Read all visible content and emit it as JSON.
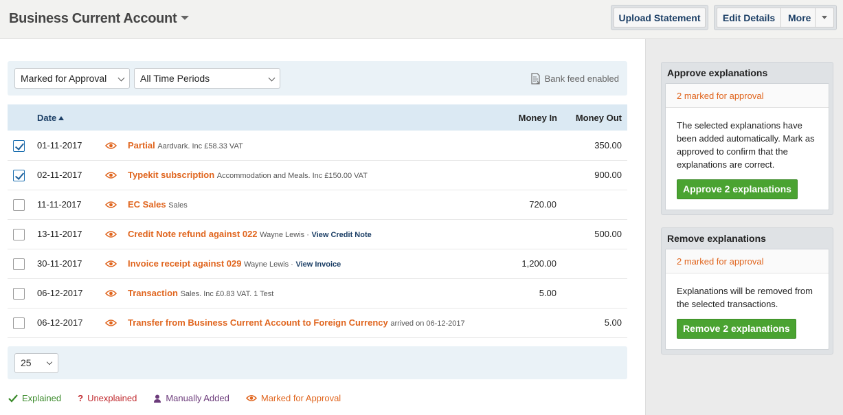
{
  "header": {
    "account_title": "Business Current Account",
    "upload_label": "Upload Statement",
    "edit_label": "Edit Details",
    "more_label": "More"
  },
  "filters": {
    "status_value": "Marked for Approval",
    "period_value": "All Time Periods",
    "bank_feed": "Bank feed enabled"
  },
  "table": {
    "col_date": "Date",
    "col_in": "Money In",
    "col_out": "Money Out",
    "rows": [
      {
        "checked": true,
        "date": "01-11-2017",
        "title": "Partial",
        "sub": "Aardvark. Inc £58.33 VAT",
        "link": "",
        "in": "",
        "out": "350.00"
      },
      {
        "checked": true,
        "date": "02-11-2017",
        "title": "Typekit subscription",
        "sub": "Accommodation and Meals. Inc £150.00 VAT",
        "link": "",
        "in": "",
        "out": "900.00"
      },
      {
        "checked": false,
        "date": "11-11-2017",
        "title": "EC Sales",
        "sub": "Sales",
        "link": "",
        "in": "720.00",
        "out": ""
      },
      {
        "checked": false,
        "date": "13-11-2017",
        "title": "Credit Note refund against 022",
        "sub": "Wayne Lewis ·",
        "link": "View Credit Note",
        "in": "",
        "out": "500.00"
      },
      {
        "checked": false,
        "date": "30-11-2017",
        "title": "Invoice receipt against 029",
        "sub": "Wayne Lewis ·",
        "link": "View Invoice",
        "in": "1,200.00",
        "out": ""
      },
      {
        "checked": false,
        "date": "06-12-2017",
        "title": "Transaction",
        "sub": "Sales. Inc £0.83 VAT. 1 Test",
        "link": "",
        "in": "5.00",
        "out": ""
      },
      {
        "checked": false,
        "date": "06-12-2017",
        "title": "Transfer from Business Current Account to Foreign Currency",
        "sub": "arrived on 06-12-2017",
        "link": "",
        "in": "",
        "out": "5.00"
      }
    ]
  },
  "pagination": {
    "per_page": "25"
  },
  "legend": {
    "explained": "Explained",
    "unexplained": "Unexplained",
    "manual": "Manually Added",
    "approval": "Marked for Approval"
  },
  "approve_panel": {
    "title": "Approve explanations",
    "status": "2 marked for approval",
    "description": "The selected explanations have been added automatically. Mark as approved to confirm that the explanations are correct.",
    "button": "Approve 2 explanations"
  },
  "remove_panel": {
    "title": "Remove explanations",
    "status": "2 marked for approval",
    "description": "Explanations will be removed from the selected transactions.",
    "button": "Remove 2 explanations"
  },
  "colors": {
    "accent_orange": "#e0651e",
    "navy": "#1c3f66",
    "green": "#4aa331",
    "explained_green": "#3a8a2a",
    "unexplained_red": "#c0282d",
    "manual_purple": "#6b3a7a"
  },
  "icons": {
    "status_eye": "eye-icon",
    "bank_feed": "document-icon",
    "explained": "checkmark-icon",
    "unexplained": "question-icon",
    "manual": "person-icon"
  }
}
